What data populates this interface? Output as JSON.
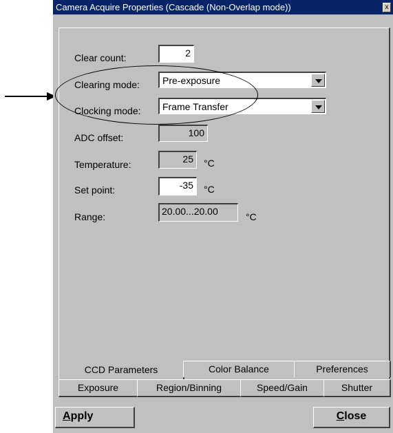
{
  "window": {
    "title": "Camera Acquire Properties (Cascade (Non-Overlap mode))",
    "close_glyph": "x"
  },
  "form": {
    "clear_count": {
      "label": "Clear count:",
      "value": "2"
    },
    "clearing_mode": {
      "label": "Clearing mode:",
      "value": "Pre-exposure"
    },
    "clocking_mode": {
      "label": "Clocking mode:",
      "value": "Frame Transfer"
    },
    "adc_offset": {
      "label": "ADC offset:",
      "value": "100"
    },
    "temperature": {
      "label": "Temperature:",
      "value": "25",
      "unit": "°C"
    },
    "set_point": {
      "label": "Set point:",
      "value": "-35",
      "unit": "°C"
    },
    "range": {
      "label": "Range:",
      "value": "20.00...20.00",
      "unit": "°C"
    }
  },
  "tabs": {
    "row1": [
      "CCD Parameters",
      "Color Balance",
      "Preferences"
    ],
    "row2": [
      "Exposure",
      "Region/Binning",
      "Speed/Gain",
      "Shutter"
    ]
  },
  "buttons": {
    "apply_first": "A",
    "apply_rest": "pply",
    "close_first": "C",
    "close_rest": "lose"
  },
  "annotation": {
    "arrow_color": "#000000"
  }
}
